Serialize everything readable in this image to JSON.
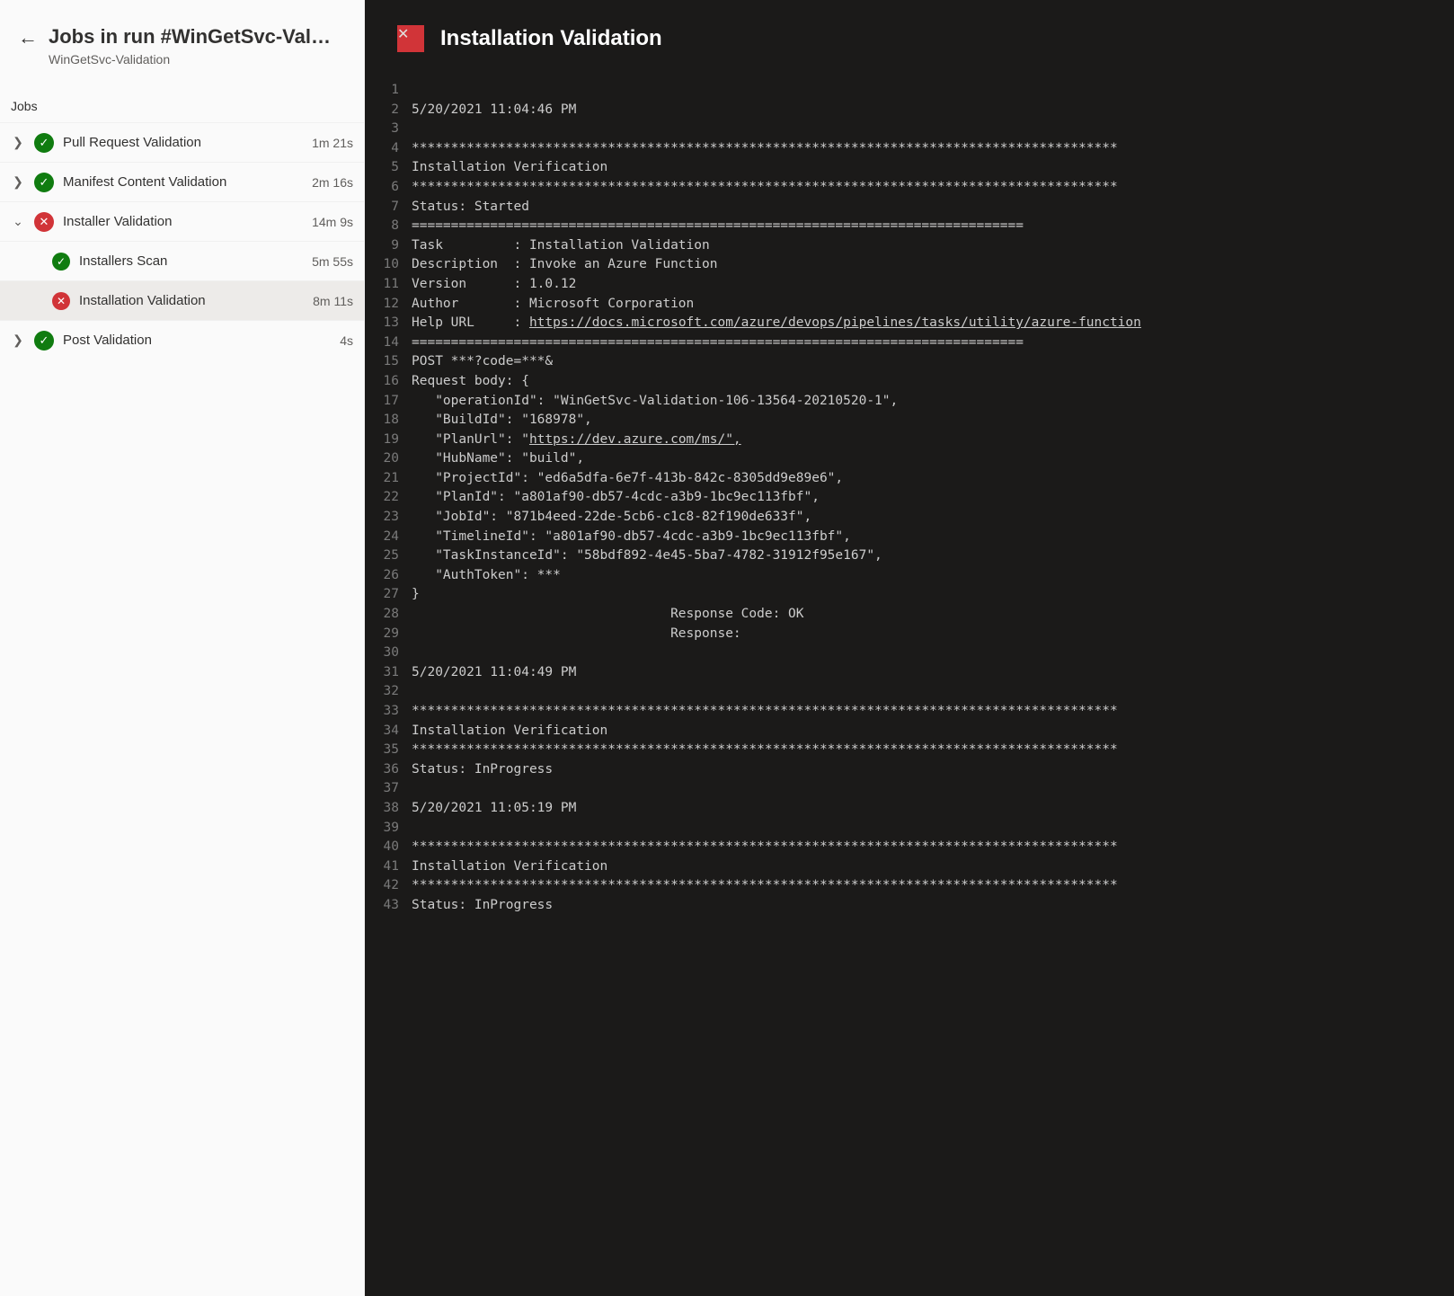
{
  "header": {
    "title": "Jobs in run #WinGetSvc-Valida…",
    "subtitle": "WinGetSvc-Validation"
  },
  "jobs_section_label": "Jobs",
  "jobs": [
    {
      "id": "pr",
      "chevron": "right",
      "status": "success",
      "label": "Pull Request Validation",
      "duration": "1m 21s"
    },
    {
      "id": "mcv",
      "chevron": "right",
      "status": "success",
      "label": "Manifest Content Validation",
      "duration": "2m 16s"
    },
    {
      "id": "iv",
      "chevron": "down",
      "status": "fail",
      "label": "Installer Validation",
      "duration": "14m 9s",
      "steps": [
        {
          "id": "scan",
          "status": "success",
          "label": "Installers Scan",
          "duration": "5m 55s"
        },
        {
          "id": "inst",
          "status": "fail",
          "label": "Installation Validation",
          "duration": "8m 11s",
          "selected": true
        }
      ]
    },
    {
      "id": "post",
      "chevron": "right",
      "status": "success",
      "label": "Post Validation",
      "duration": "4s"
    }
  ],
  "right": {
    "status": "fail",
    "title": "Installation Validation"
  },
  "log": [
    {
      "n": 1,
      "t": ""
    },
    {
      "n": 2,
      "t": "5/20/2021 11:04:46 PM"
    },
    {
      "n": 3,
      "t": ""
    },
    {
      "n": 4,
      "t": "******************************************************************************************"
    },
    {
      "n": 5,
      "t": "Installation Verification"
    },
    {
      "n": 6,
      "t": "******************************************************************************************"
    },
    {
      "n": 7,
      "t": "Status: Started"
    },
    {
      "n": 8,
      "t": "=============================================================================="
    },
    {
      "n": 9,
      "t": "Task         : Installation Validation"
    },
    {
      "n": 10,
      "t": "Description  : Invoke an Azure Function"
    },
    {
      "n": 11,
      "t": "Version      : 1.0.12"
    },
    {
      "n": 12,
      "t": "Author       : Microsoft Corporation"
    },
    {
      "n": 13,
      "prefix": "Help URL     : ",
      "link": "https://docs.microsoft.com/azure/devops/pipelines/tasks/utility/azure-function"
    },
    {
      "n": 14,
      "t": "=============================================================================="
    },
    {
      "n": 15,
      "t": "POST ***?code=***&"
    },
    {
      "n": 16,
      "t": "Request body: {"
    },
    {
      "n": 17,
      "t": "   \"operationId\": \"WinGetSvc-Validation-106-13564-20210520-1\","
    },
    {
      "n": 18,
      "t": "   \"BuildId\": \"168978\","
    },
    {
      "n": 19,
      "prefix": "   \"PlanUrl\": \"",
      "link": "https://dev.azure.com/ms/\","
    },
    {
      "n": 20,
      "t": "   \"HubName\": \"build\","
    },
    {
      "n": 21,
      "t": "   \"ProjectId\": \"ed6a5dfa-6e7f-413b-842c-8305dd9e89e6\","
    },
    {
      "n": 22,
      "t": "   \"PlanId\": \"a801af90-db57-4cdc-a3b9-1bc9ec113fbf\","
    },
    {
      "n": 23,
      "t": "   \"JobId\": \"871b4eed-22de-5cb6-c1c8-82f190de633f\","
    },
    {
      "n": 24,
      "t": "   \"TimelineId\": \"a801af90-db57-4cdc-a3b9-1bc9ec113fbf\","
    },
    {
      "n": 25,
      "t": "   \"TaskInstanceId\": \"58bdf892-4e45-5ba7-4782-31912f95e167\","
    },
    {
      "n": 26,
      "t": "   \"AuthToken\": ***"
    },
    {
      "n": 27,
      "t": "}"
    },
    {
      "n": 28,
      "t": "                                 Response Code: OK"
    },
    {
      "n": 29,
      "t": "                                 Response:"
    },
    {
      "n": 30,
      "t": ""
    },
    {
      "n": 31,
      "t": "5/20/2021 11:04:49 PM"
    },
    {
      "n": 32,
      "t": ""
    },
    {
      "n": 33,
      "t": "******************************************************************************************"
    },
    {
      "n": 34,
      "t": "Installation Verification"
    },
    {
      "n": 35,
      "t": "******************************************************************************************"
    },
    {
      "n": 36,
      "t": "Status: InProgress"
    },
    {
      "n": 37,
      "t": ""
    },
    {
      "n": 38,
      "t": "5/20/2021 11:05:19 PM"
    },
    {
      "n": 39,
      "t": ""
    },
    {
      "n": 40,
      "t": "******************************************************************************************"
    },
    {
      "n": 41,
      "t": "Installation Verification"
    },
    {
      "n": 42,
      "t": "******************************************************************************************"
    },
    {
      "n": 43,
      "t": "Status: InProgress"
    }
  ],
  "glyphs": {
    "success": "✓",
    "fail": "✕",
    "chev_right": "❯",
    "chev_down": "⌄",
    "back": "←"
  }
}
